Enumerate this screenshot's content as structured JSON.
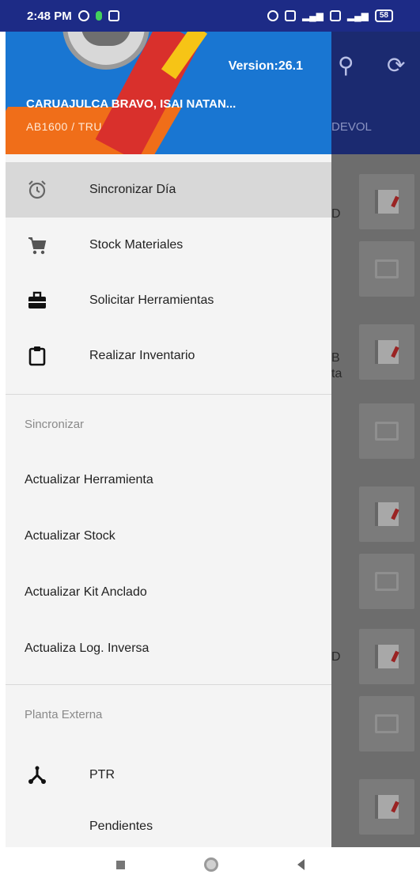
{
  "status_bar": {
    "time": "2:48 PM",
    "battery": "58"
  },
  "background_app": {
    "tab_label": "DEVOL",
    "fragments": [
      "D",
      "B",
      "ta",
      "D"
    ]
  },
  "drawer": {
    "header": {
      "version": "Version:26.1",
      "user_name": "CARUAJULCA BRAVO, ISAI NATAN...",
      "user_code": "AB1600  /  TRU"
    },
    "main_items": [
      {
        "label": "Sincronizar Día",
        "icon": "alarm-clock-icon",
        "active": true
      },
      {
        "label": "Stock Materiales",
        "icon": "shopping-cart-icon"
      },
      {
        "label": "Solicitar Herramientas",
        "icon": "toolbox-icon"
      },
      {
        "label": "Realizar Inventario",
        "icon": "clipboard-icon"
      }
    ],
    "sync_section": {
      "title": "Sincronizar",
      "items": [
        "Actualizar Herramienta",
        "Actualizar Stock",
        "Actualizar Kit Anclado",
        "Actualiza Log. Inversa"
      ]
    },
    "external_section": {
      "title": "Planta Externa",
      "items": [
        {
          "label": "PTR",
          "icon": "branch-icon"
        },
        {
          "label": "Pendientes",
          "icon": ""
        }
      ]
    }
  },
  "colors": {
    "status_bar": "#1d2b86",
    "header_blue": "#1976d2",
    "header_orange": "#f06e19",
    "active_item_bg": "#d8d8d8"
  }
}
